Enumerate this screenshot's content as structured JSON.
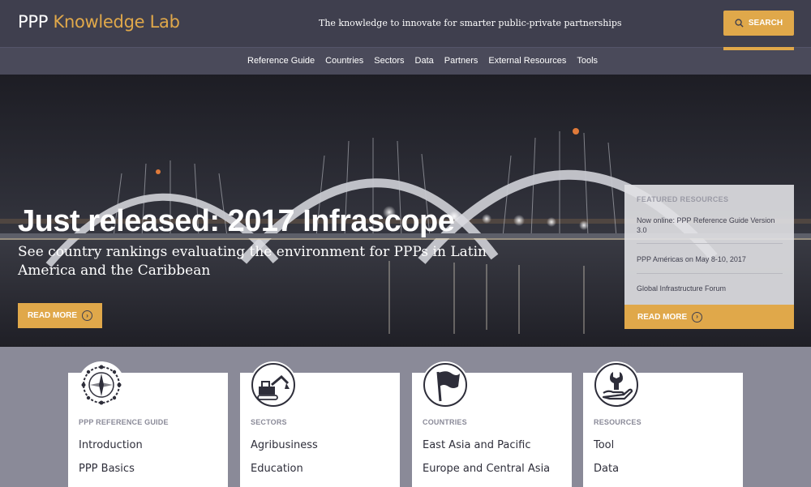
{
  "header": {
    "logo_ppp": "PPP",
    "logo_rest": "Knowledge Lab",
    "tagline": "The knowledge to innovate for smarter public-private partnerships",
    "search_label": "SEARCH"
  },
  "nav": {
    "items": [
      "Reference Guide",
      "Countries",
      "Sectors",
      "Data",
      "Partners",
      "External Resources",
      "Tools"
    ]
  },
  "hero": {
    "title": "Just released: 2017 Infrascope",
    "subtitle": "See country rankings evaluating the environment for PPPs in Latin America and the Caribbean",
    "read_more": "READ MORE"
  },
  "featured": {
    "heading": "FEATURED RESOURCES",
    "items": [
      "Now online: PPP Reference Guide Version 3.0",
      "PPP Américas on May 8-10, 2017",
      "Global Infrastructure Forum"
    ],
    "read_more": "READ MORE"
  },
  "cards": [
    {
      "category": "PPP REFERENCE GUIDE",
      "icon": "compass-icon",
      "links": [
        "Introduction",
        "PPP Basics"
      ]
    },
    {
      "category": "SECTORS",
      "icon": "excavator-icon",
      "links": [
        "Agribusiness",
        "Education"
      ]
    },
    {
      "category": "COUNTRIES",
      "icon": "flag-icon",
      "links": [
        "East Asia and Pacific",
        "Europe and Central Asia"
      ]
    },
    {
      "category": "RESOURCES",
      "icon": "wrench-hand-icon",
      "links": [
        "Tool",
        "Data"
      ]
    }
  ],
  "colors": {
    "header_bg": "#3f3f4e",
    "accent": "#e0a84a",
    "page_bg": "#8a8a98"
  }
}
